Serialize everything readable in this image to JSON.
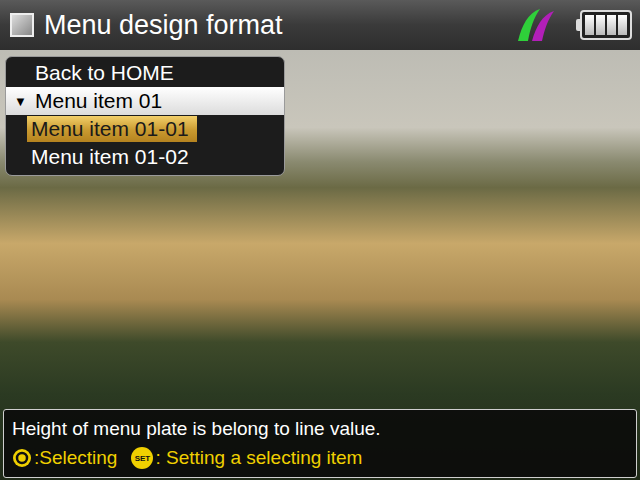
{
  "window": {
    "title": "Menu design format"
  },
  "status": {
    "battery": {
      "level": 1,
      "segments": 4
    }
  },
  "menu": {
    "items": [
      {
        "label": "Back to HOME",
        "kind": "link",
        "selected": false
      },
      {
        "label": "Menu item 01",
        "kind": "group",
        "expanded": true,
        "marker": "▼",
        "selected": false
      },
      {
        "label": "Menu item 01-01",
        "kind": "child",
        "selected": true
      },
      {
        "label": "Menu item 01-02",
        "kind": "child",
        "selected": false
      }
    ]
  },
  "help": {
    "text": "Height of menu plate is belong to line value.",
    "hints": [
      {
        "key": "",
        "kind": "dial",
        "label": ":Selecting"
      },
      {
        "key": "SET",
        "kind": "set",
        "label": ": Setting a selecting item"
      }
    ]
  }
}
